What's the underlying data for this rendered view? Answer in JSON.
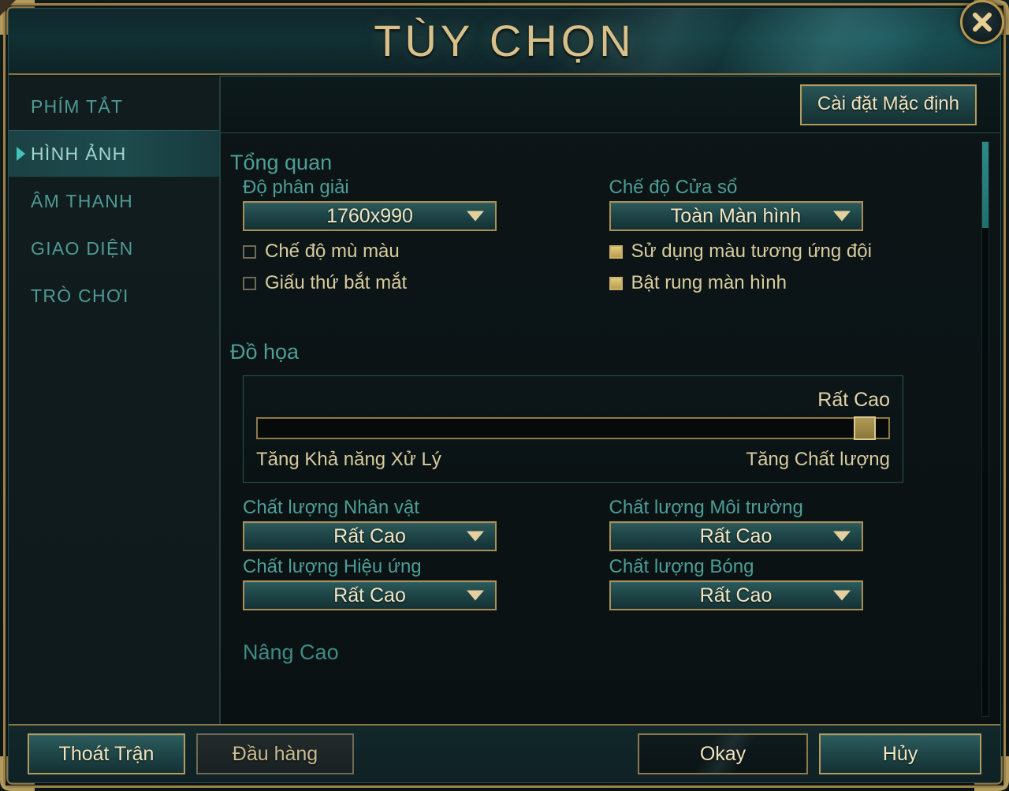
{
  "window": {
    "title": "TÙY CHỌN",
    "close_icon": "close-x-icon"
  },
  "sidebar": {
    "items": [
      {
        "label": "PHÍM TẮT",
        "active": false
      },
      {
        "label": "HÌNH ẢNH",
        "active": true
      },
      {
        "label": "ÂM THANH",
        "active": false
      },
      {
        "label": "GIAO DIỆN",
        "active": false
      },
      {
        "label": "TRÒ CHƠI",
        "active": false
      }
    ]
  },
  "toolbar": {
    "defaults_label": "Cài đặt Mặc định"
  },
  "overview": {
    "section_title": "Tổng quan",
    "resolution_label": "Độ phân giải",
    "resolution_value": "1760x990",
    "window_mode_label": "Chế độ Cửa sổ",
    "window_mode_value": "Toàn Màn hình",
    "checkboxes": [
      {
        "label": "Chế độ mù màu",
        "checked": false,
        "column": "left"
      },
      {
        "label": "Giấu thứ bắt mắt",
        "checked": false,
        "column": "left"
      },
      {
        "label": "Sử dụng màu tương ứng đội",
        "checked": true,
        "column": "right"
      },
      {
        "label": "Bật rung màn hình",
        "checked": true,
        "column": "right"
      }
    ]
  },
  "graphics": {
    "section_title": "Đồ họa",
    "slider_value_label": "Rất Cao",
    "slider_percent": 98,
    "left_hint": "Tăng Khả năng Xử Lý",
    "right_hint": "Tăng Chất lượng",
    "quality": [
      {
        "label": "Chất lượng Nhân vật",
        "value": "Rất Cao"
      },
      {
        "label": "Chất lượng Môi trường",
        "value": "Rất Cao"
      },
      {
        "label": "Chất lượng Hiệu ứng",
        "value": "Rất Cao"
      },
      {
        "label": "Chất lượng Bóng",
        "value": "Rất Cao"
      }
    ]
  },
  "advanced": {
    "section_title": "Nâng Cao"
  },
  "footer": {
    "exit_match": "Thoát Trận",
    "surrender": "Đầu hàng",
    "okay": "Okay",
    "cancel": "Hủy"
  },
  "scrollbar": {
    "thumb_position_percent": 0
  },
  "colors": {
    "gold": "#b39a5e",
    "gold_text": "#d7c08a",
    "teal_label": "#4e9e96",
    "cream_text": "#f1e5c0",
    "active_marker": "#43c3b8"
  }
}
